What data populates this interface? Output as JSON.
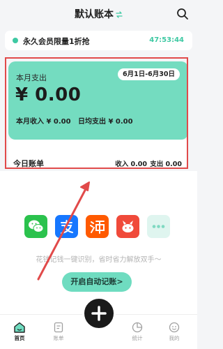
{
  "header": {
    "title": "默认账本",
    "swap_icon": "swap-icon",
    "search_icon": "search-icon"
  },
  "promo": {
    "text": "永久会员限量1折抢",
    "timer": "47:53:44"
  },
  "card": {
    "label": "本月支出",
    "date_range": "6月1日-6月30日",
    "amount": "¥ 0.00",
    "income": "本月收入 ¥ 0.00",
    "daily_expense": "日均支出 ¥ 0.00"
  },
  "today": {
    "title": "今日账单",
    "income": "收入 0.00",
    "expense": "支出 0.00"
  },
  "apps": [
    {
      "name": "wechat-icon",
      "color": "#2bc24d"
    },
    {
      "name": "alipay-icon",
      "color": "#1677ff"
    },
    {
      "name": "taobao-icon",
      "color": "#ff5a00"
    },
    {
      "name": "jd-icon",
      "color": "#f04a3a"
    },
    {
      "name": "more-icon",
      "color": "#dff5ef"
    }
  ],
  "hint": "花钱记钱一键识别，省时省力解放双手～",
  "auto_button": "开启自动记账>",
  "nav": {
    "home": "首页",
    "bill": "账单",
    "stats": "统计",
    "mine": "我的"
  },
  "colors": {
    "accent": "#74dcc0",
    "highlight": "#e14a4a"
  }
}
